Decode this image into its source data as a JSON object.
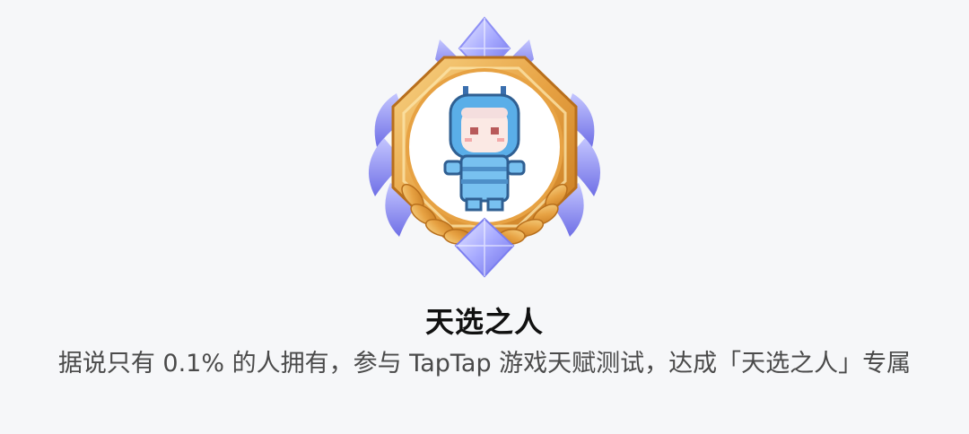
{
  "badge": {
    "icon": "chosen-one-badge-icon",
    "colors": {
      "gold": "#e8a94a",
      "gold_dark": "#c77c22",
      "purple": "#7b7ef0",
      "purple_light": "#b7b9ff",
      "avatar_blue": "#5aaee8"
    }
  },
  "achievement": {
    "title": "天选之人",
    "description": "据说只有 0.1% 的人拥有，参与 TapTap 游戏天赋测试，达成「天选之人」专属"
  }
}
